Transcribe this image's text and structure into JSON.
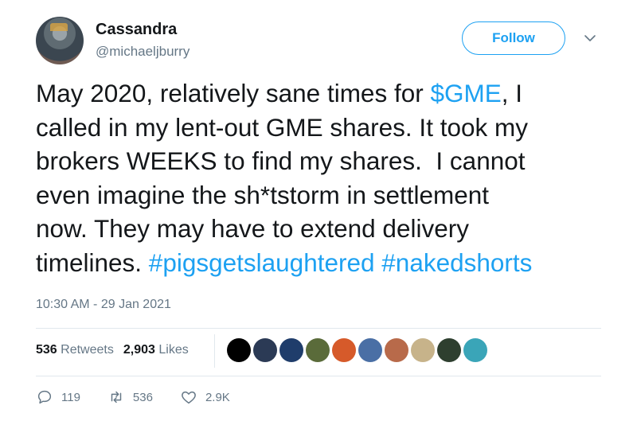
{
  "header": {
    "name": "Cassandra",
    "handle": "@michaeljburry",
    "follow_label": "Follow"
  },
  "tweet": {
    "part1": "May 2020, relatively sane times for ",
    "cashtag": "$GME",
    "part2": ", I\ncalled in my lent-out GME shares. It took my\nbrokers WEEKS to find my shares.  I cannot\neven imagine the sh*tstorm in settlement\nnow. They may have to extend delivery\ntimelines. ",
    "hashtag1": "#pigsgetslaughtered",
    "hashtag2": "#nakedshorts"
  },
  "timestamp": "10:30 AM - 29 Jan 2021",
  "stats": {
    "retweets_count": "536",
    "retweets_label": "Retweets",
    "likes_count": "2,903",
    "likes_label": "Likes"
  },
  "likers": [
    "#000000",
    "#2b3a55",
    "#1f3d6b",
    "#5a6b3a",
    "#d65a2a",
    "#4a6fa5",
    "#b86a4a",
    "#c7b38a",
    "#2e3f2f",
    "#3aa5b8"
  ],
  "actions": {
    "replies": "119",
    "retweets": "536",
    "likes": "2.9K"
  },
  "colors": {
    "accent": "#1da1f2",
    "muted": "#657786",
    "text": "#14171a"
  }
}
